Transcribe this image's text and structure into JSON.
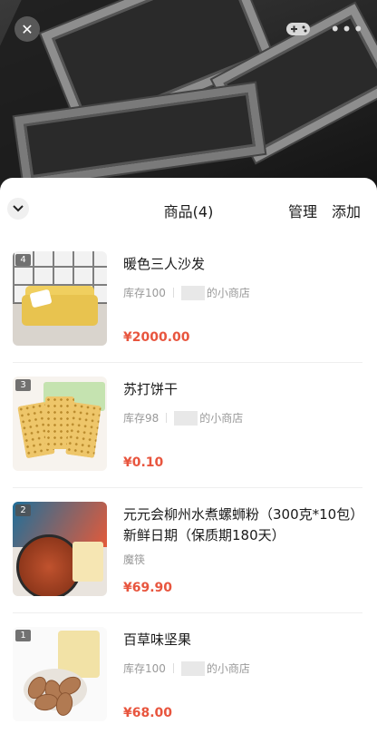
{
  "header": {
    "title": "商品(4)",
    "manage_label": "管理",
    "add_label": "添加"
  },
  "products": [
    {
      "rank": "4",
      "name": "暖色三人沙发",
      "stock": "库存100",
      "shop": "的小商店",
      "price": "¥2000.00"
    },
    {
      "rank": "3",
      "name": "苏打饼干",
      "stock": "库存98",
      "shop": "的小商店",
      "price": "¥0.10"
    },
    {
      "rank": "2",
      "name": "元元会柳州水煮螺蛳粉（300克*10包）新鲜日期（保质期180天）",
      "stock": "",
      "shop": "魔筷",
      "price": "¥69.90"
    },
    {
      "rank": "1",
      "name": "百草味坚果",
      "stock": "库存100",
      "shop": "的小商店",
      "price": "¥68.00"
    }
  ],
  "icons": {
    "close": "close-icon",
    "game": "gamepad-icon",
    "more": "more-icon",
    "collapse": "chevron-down-icon"
  },
  "colors": {
    "price": "#e8553e",
    "sheet_bg": "#ffffff"
  }
}
